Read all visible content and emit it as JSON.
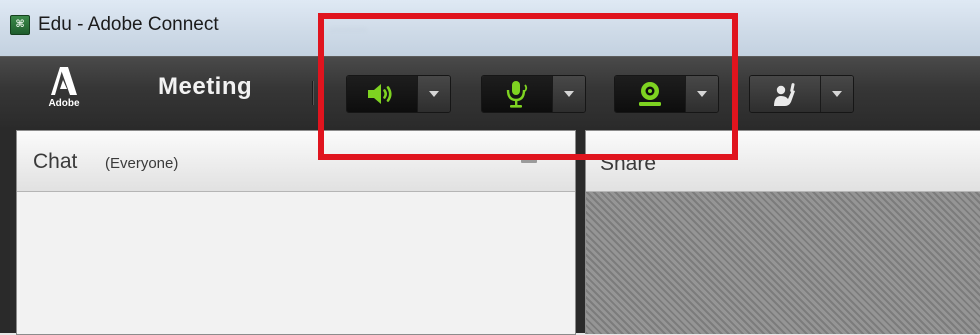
{
  "window": {
    "app_icon_glyph": "⌘",
    "title": "Edu - Adobe Connect"
  },
  "toolbar": {
    "logo_text": "Adobe",
    "meeting_menu": "Meeting",
    "buttons": [
      {
        "name": "speaker",
        "icon": "speaker-icon",
        "state": "on",
        "color": "#7ed321"
      },
      {
        "name": "microphone",
        "icon": "microphone-icon",
        "state": "on",
        "color": "#7ed321"
      },
      {
        "name": "camera",
        "icon": "webcam-icon",
        "state": "on",
        "color": "#7ed321"
      },
      {
        "name": "raise-hand",
        "icon": "raise-hand-icon",
        "state": "off",
        "color": "#e6e6e6"
      }
    ]
  },
  "chat_pod": {
    "title": "Chat",
    "scope": "(Everyone)"
  },
  "share_pod": {
    "title": "Share"
  },
  "colors": {
    "active_green": "#7ed321",
    "highlight_red": "#e0141e"
  }
}
